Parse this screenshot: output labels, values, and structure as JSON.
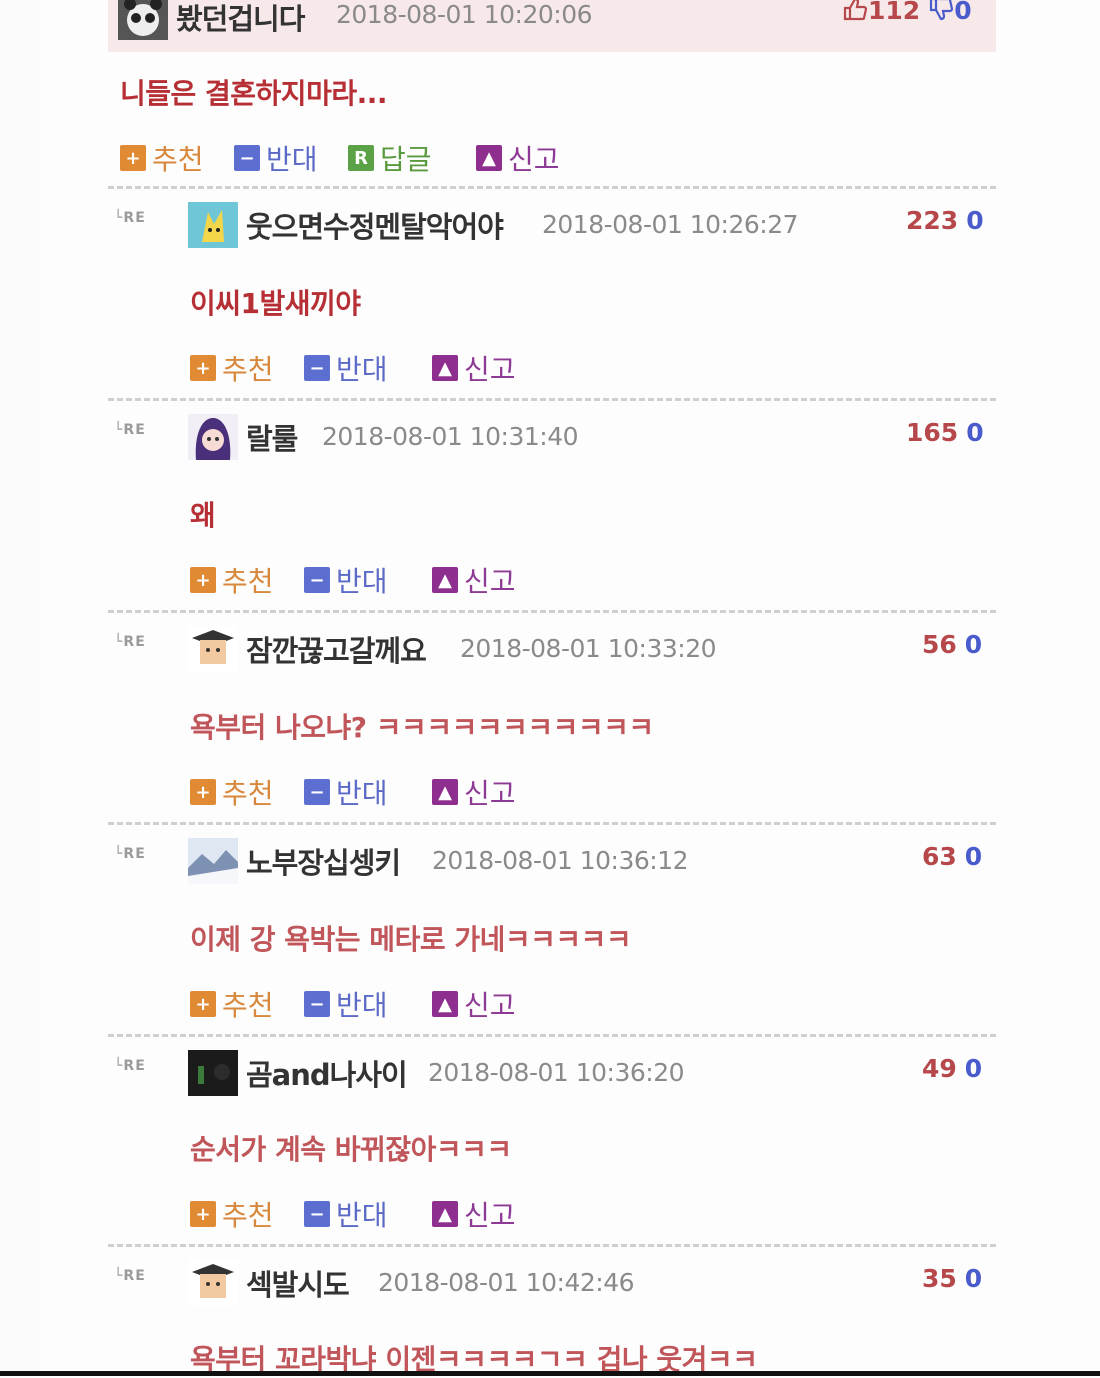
{
  "top_comment": {
    "nickname": "봤던겁니다",
    "timestamp": "2018-08-01 10:20:06",
    "upvotes": "112",
    "downvotes": "0",
    "text": "니들은 결혼하지마라...",
    "actions": {
      "recommend": "추천",
      "oppose": "반대",
      "reply": "답글",
      "report": "신고"
    },
    "reply_icon_letter": "R"
  },
  "reply_marker": "└RE",
  "replies": [
    {
      "nickname": "웃으면수정멘탈악어야",
      "timestamp": "2018-08-01 10:26:27",
      "upvotes": "223",
      "downvotes": "0",
      "text": "이씨1발새끼야",
      "avatar_icon": "pikachu-avatar-icon"
    },
    {
      "nickname": "랄룰",
      "timestamp": "2018-08-01 10:31:40",
      "upvotes": "165",
      "downvotes": "0",
      "text": "왜",
      "avatar_icon": "anime-girl-avatar-icon"
    },
    {
      "nickname": "잠깐끊고갈께요",
      "timestamp": "2018-08-01 10:33:20",
      "upvotes": "56",
      "downvotes": "0",
      "text": "욕부터 나오냐? ㅋㅋㅋㅋㅋㅋㅋㅋㅋㅋㅋ",
      "avatar_icon": "graduate-avatar-icon"
    },
    {
      "nickname": "노부장십셍키",
      "timestamp": "2018-08-01 10:36:12",
      "upvotes": "63",
      "downvotes": "0",
      "text": "이제 강 욕박는 메타로 가네ㅋㅋㅋㅋㅋ",
      "avatar_icon": "landscape-avatar-icon"
    },
    {
      "nickname": "곰and나사이",
      "timestamp": "2018-08-01 10:36:20",
      "upvotes": "49",
      "downvotes": "0",
      "text": "순서가 계속 바뀌잖아ㅋㅋㅋ",
      "avatar_icon": "dark-avatar-icon"
    },
    {
      "nickname": "섹발시도",
      "timestamp": "2018-08-01 10:42:46",
      "upvotes": "35",
      "downvotes": "0",
      "text": "욕부터 꼬라박냐 이젠ㅋㅋㅋㅋㄱㅋ 겁나 웃겨ㅋㅋ",
      "avatar_icon": "graduate-avatar-icon"
    }
  ],
  "reply_actions": {
    "recommend": "추천",
    "oppose": "반대",
    "report": "신고"
  },
  "colors": {
    "top_bg": "#f7e8ea",
    "upvote": "#b6474a",
    "downvote": "#4a5ccc",
    "comment_text": "#b62f35",
    "recommend": "#e08a34",
    "oppose": "#5c6fd0",
    "reply": "#5aa245",
    "report": "#8e2f8f"
  }
}
